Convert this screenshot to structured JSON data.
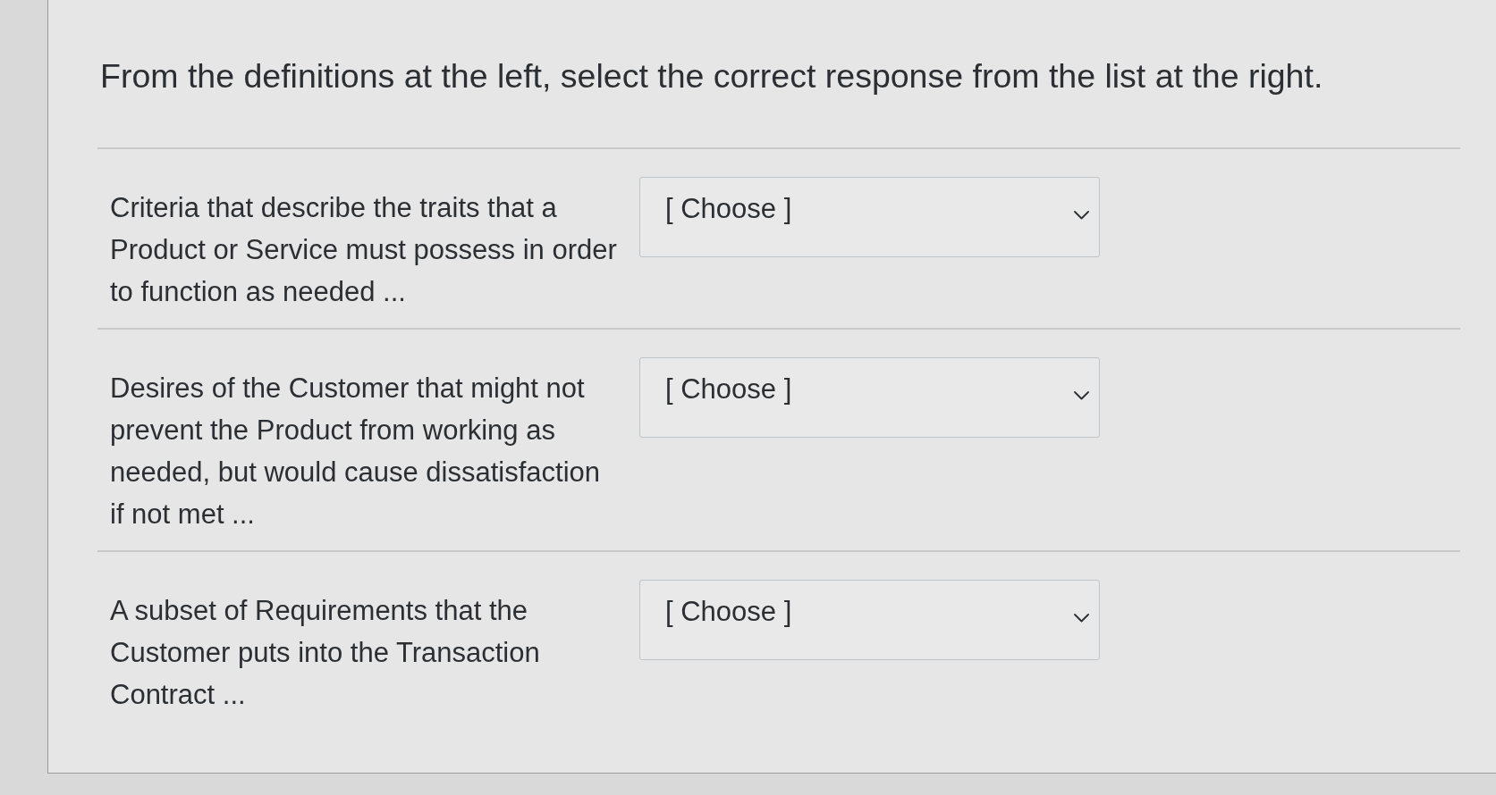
{
  "question": {
    "text": "From the definitions at the left, select the correct response from the list at the right."
  },
  "items": [
    {
      "definition": "Criteria that describe the traits that a Product or Service must possess in order to function as needed ...",
      "answer": {
        "value": "[ Choose ]"
      }
    },
    {
      "definition": "Desires of the Customer that might not prevent the Product from working as needed, but would cause dissatisfaction if not met ...",
      "answer": {
        "value": "[ Choose ]"
      }
    },
    {
      "definition": "A subset of Requirements that the Customer puts into the Transaction Contract ...",
      "answer": {
        "value": "[ Choose ]"
      }
    }
  ]
}
